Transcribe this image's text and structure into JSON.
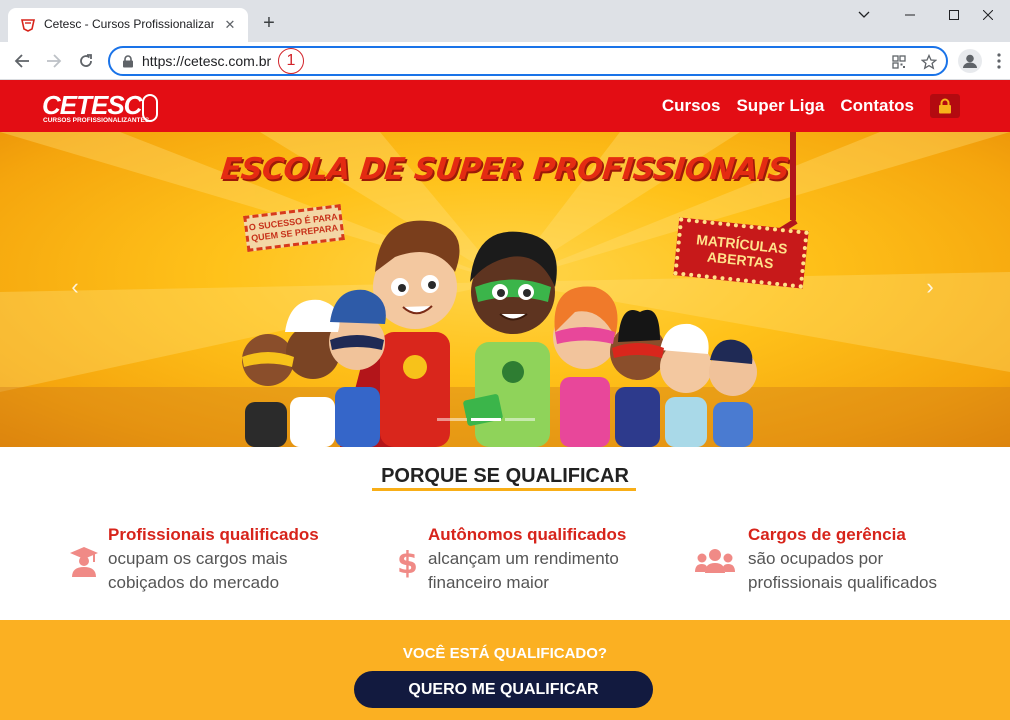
{
  "browser": {
    "tab_title": "Cetesc - Cursos Profissionalizantes",
    "tab_close": "✕",
    "new_tab": "+",
    "url": "https://cetesc.com.br",
    "marker": "1"
  },
  "site": {
    "logo_text": "CETESC",
    "logo_subtitle": "CURSOS PROFISSIONALIZANTES",
    "nav": [
      "Cursos",
      "Super Liga",
      "Contatos"
    ]
  },
  "hero": {
    "title": "ESCOLA DE SUPER PROFISSIONAIS",
    "sign_left": "O SUCESSO É PARA QUEM SE PREPARA",
    "sign_right": "MATRÍCULAS ABERTAS",
    "prev_arrow": "‹",
    "next_arrow": "›",
    "slide_count": 3,
    "active_slide": 2
  },
  "qualify": {
    "title": "PORQUE SE QUALIFICAR",
    "features": [
      {
        "icon": "graduate-icon",
        "title": "Profissionais qualificados",
        "line1": "ocupam os cargos mais",
        "line2": "cobiçados do mercado"
      },
      {
        "icon": "dollar-icon",
        "title": "Autônomos qualificados",
        "line1": "alcançam um rendimento",
        "line2": "financeiro maior"
      },
      {
        "icon": "users-icon",
        "title": "Cargos de gerência",
        "line1": "são ocupados por",
        "line2": "profissionais qualificados"
      }
    ]
  },
  "cta": {
    "question": "VOCÊ ESTÁ QUALIFICADO?",
    "button": "QUERO ME QUALIFICAR"
  },
  "colors": {
    "header_red": "#e30d14",
    "accent_orange": "#fbb022",
    "cta_navy": "#121a3f",
    "feature_red": "#d7241b"
  }
}
